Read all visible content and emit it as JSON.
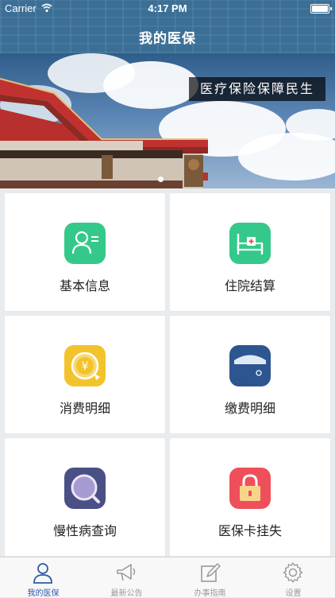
{
  "status_bar": {
    "carrier": "Carrier",
    "time": "4:17 PM"
  },
  "header": {
    "title": "我的医保"
  },
  "banner": {
    "slogan": "医疗保险保障民生",
    "page_count": 1,
    "active_page": 1
  },
  "services": [
    {
      "label": "基本信息",
      "icon": "id-card-icon",
      "color": "#34c98a"
    },
    {
      "label": "住院结算",
      "icon": "hospital-bed-icon",
      "color": "#34c98a"
    },
    {
      "label": "消费明细",
      "icon": "yuan-coin-icon",
      "color": "#f3c32c"
    },
    {
      "label": "缴费明细",
      "icon": "wallet-icon",
      "color": "#2d5590"
    },
    {
      "label": "慢性病查询",
      "icon": "magnifier-icon",
      "color": "#4a4f86"
    },
    {
      "label": "医保卡挂失",
      "icon": "lock-icon",
      "color": "#ef4f5b"
    }
  ],
  "tabbar": {
    "items": [
      {
        "label": "我的医保",
        "icon": "person-icon",
        "active": true
      },
      {
        "label": "最新公告",
        "icon": "megaphone-icon",
        "active": false
      },
      {
        "label": "办事指南",
        "icon": "edit-note-icon",
        "active": false
      },
      {
        "label": "设置",
        "icon": "gear-icon",
        "active": false
      }
    ],
    "active_color": "#2e5aa7",
    "inactive_color": "#9a9a9a"
  }
}
